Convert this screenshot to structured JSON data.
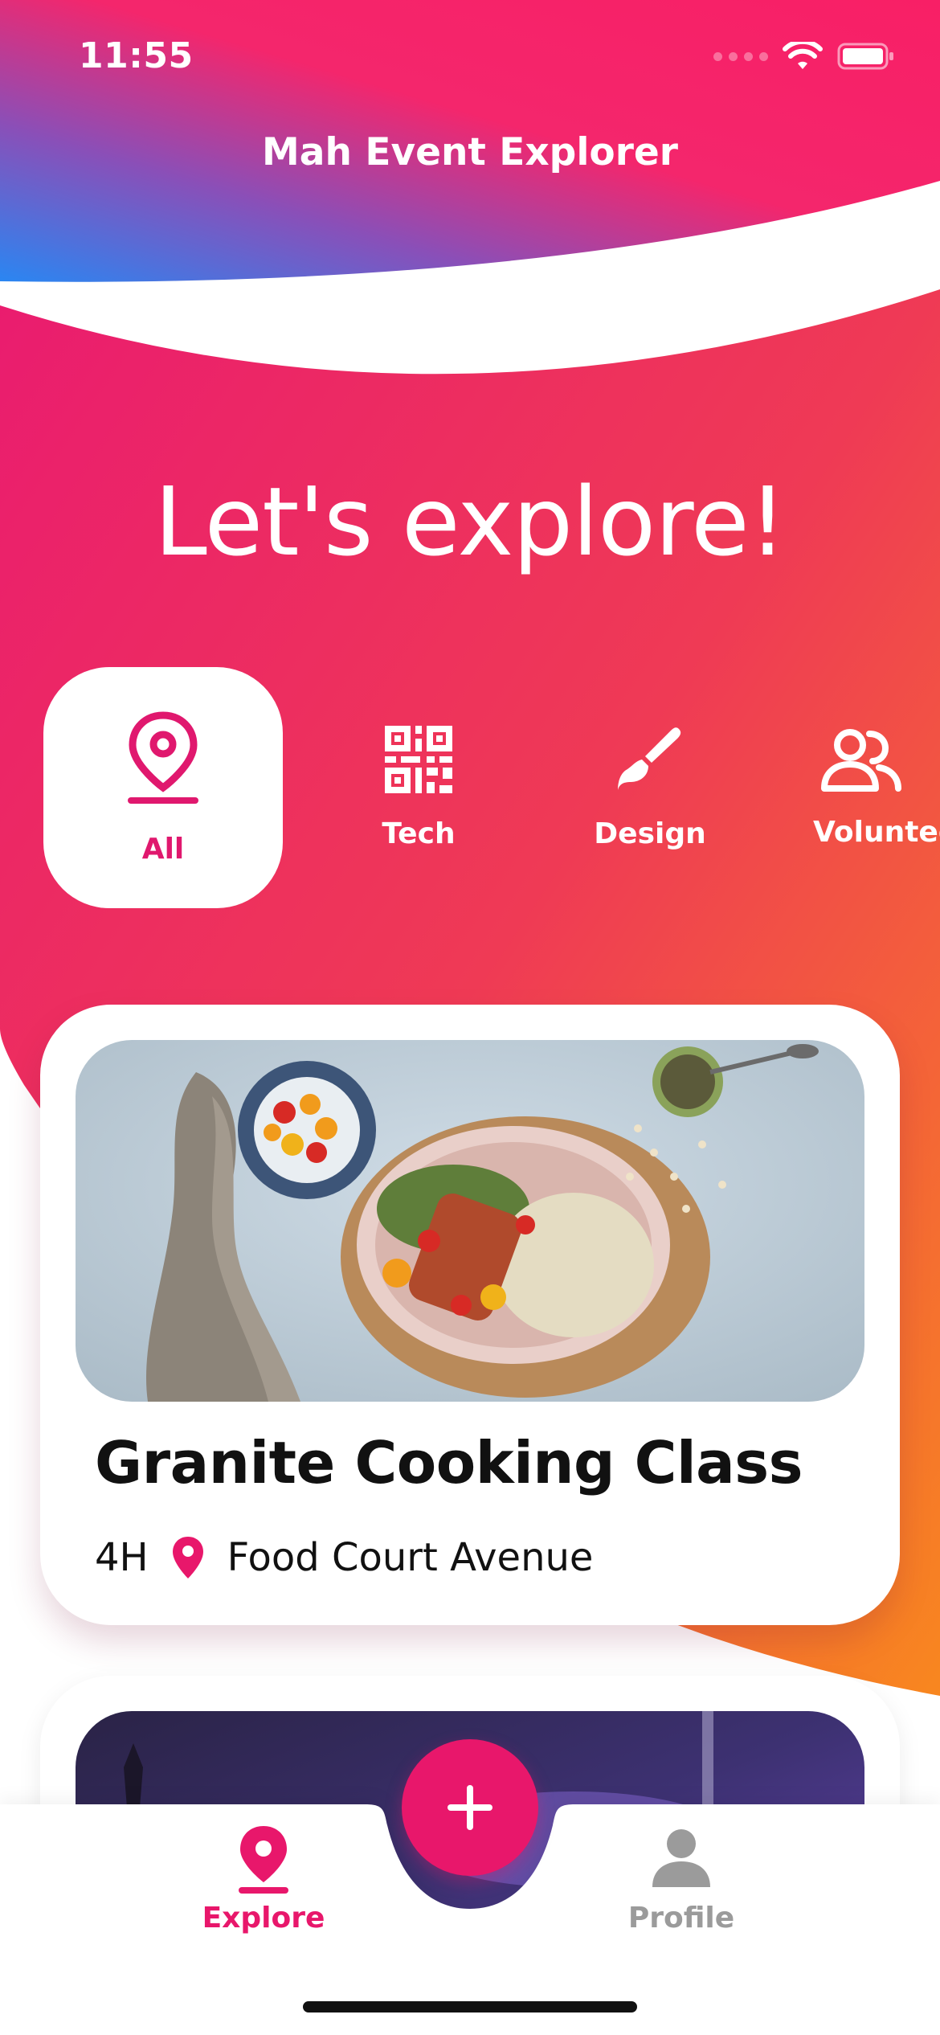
{
  "status_bar": {
    "time": "11:55"
  },
  "app": {
    "title": "Mah Event Explorer"
  },
  "hero": {
    "text": "Let's explore!"
  },
  "categories": [
    {
      "label": "All",
      "icon": "location-pin-icon",
      "active": true
    },
    {
      "label": "Tech",
      "icon": "qr-code-icon",
      "active": false
    },
    {
      "label": "Design",
      "icon": "paintbrush-icon",
      "active": false
    },
    {
      "label": "Voluntee",
      "icon": "users-icon",
      "active": false
    }
  ],
  "events": [
    {
      "title": "Granite Cooking Class",
      "duration": "4H",
      "location": "Food Court Avenue",
      "image": "food-plate-photo"
    },
    {
      "image": "concert-stage-photo"
    }
  ],
  "tabs": {
    "explore": {
      "label": "Explore",
      "icon": "location-pin-icon",
      "active": true
    },
    "add": {
      "icon": "plus-icon"
    },
    "profile": {
      "label": "Profile",
      "icon": "person-icon",
      "active": false
    }
  },
  "colors": {
    "accent": "#e8176b",
    "gradient_start": "#e8176b",
    "gradient_end": "#f7862a",
    "header_blue": "#2d8cf0",
    "inactive": "#9b9b9b"
  }
}
